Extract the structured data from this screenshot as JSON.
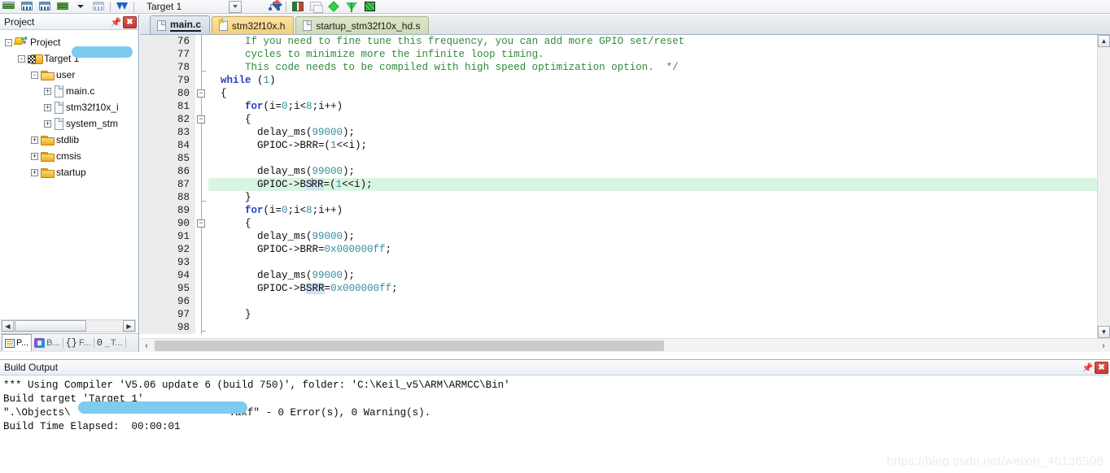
{
  "toolbar": {
    "icons": [
      "books-icon",
      "grid-build-icon",
      "grid-rebuild-icon",
      "batch-build-icon",
      "dropdown-caret-icon",
      "stop-build-icon",
      "download-icon"
    ],
    "target_label": "Target 1",
    "right_icons": [
      "target-options-icon",
      "manage-components-icon",
      "multi-project-icon",
      "debug-diamond-icon",
      "funnel-icon",
      "globe-icon"
    ]
  },
  "project_panel": {
    "title": "Project",
    "pin_glyph": "τ",
    "close_glyph": "✖",
    "tree": [
      {
        "label": "Project",
        "icon": "project-icon",
        "depth": 0,
        "expander": "-",
        "redacted": true
      },
      {
        "label": "Target 1",
        "icon": "target-icon",
        "depth": 1,
        "expander": "-",
        "redacted": false
      },
      {
        "label": "user",
        "icon": "folder-open-icon",
        "depth": 2,
        "expander": "-",
        "redacted": false
      },
      {
        "label": "main.c",
        "icon": "file-icon",
        "depth": 3,
        "expander": "+",
        "redacted": false
      },
      {
        "label": "stm32f10x_i",
        "icon": "file-icon",
        "depth": 3,
        "expander": "+",
        "redacted": false
      },
      {
        "label": "system_stm",
        "icon": "file-icon",
        "depth": 3,
        "expander": "+",
        "redacted": false
      },
      {
        "label": "stdlib",
        "icon": "folder-icon",
        "depth": 2,
        "expander": "+",
        "redacted": false
      },
      {
        "label": "cmsis",
        "icon": "folder-icon",
        "depth": 2,
        "expander": "+",
        "redacted": false
      },
      {
        "label": "startup",
        "icon": "folder-icon",
        "depth": 2,
        "expander": "+",
        "redacted": false
      }
    ],
    "bottom_tabs": [
      {
        "label": "P...",
        "icon": "project-tab-icon",
        "active": true
      },
      {
        "label": "B...",
        "icon": "books-tab-icon",
        "active": false
      },
      {
        "label": "F...",
        "icon": "functions-tab-icon",
        "active": false
      },
      {
        "label": "T...",
        "icon": "templates-tab-icon",
        "active": false
      }
    ],
    "scroll_left_glyph": "◀",
    "scroll_right_glyph": "▶"
  },
  "editor": {
    "tabs": [
      {
        "label": "main.c",
        "style": "active",
        "icon": "file-icon"
      },
      {
        "label": "stm32f10x.h",
        "style": "yellow",
        "icon": "file-key-icon"
      },
      {
        "label": "startup_stm32f10x_hd.s",
        "style": "green",
        "icon": "file-icon"
      }
    ],
    "tab_dropdown_glyph": "▼",
    "tab_close_glyph": "✕",
    "first_line": 76,
    "highlight_line": 87,
    "lines": [
      {
        "n": 76,
        "fold": "none",
        "tokens": [
          {
            "t": "      ",
            "c": "pun"
          },
          {
            "t": "If you need to fine tune this frequency, you can add more GPIO set/reset",
            "c": "cmt"
          }
        ]
      },
      {
        "n": 77,
        "fold": "none",
        "tokens": [
          {
            "t": "      ",
            "c": "pun"
          },
          {
            "t": "cycles to minimize more the infinite loop timing.",
            "c": "cmt"
          }
        ]
      },
      {
        "n": 78,
        "fold": "tick",
        "tokens": [
          {
            "t": "      ",
            "c": "pun"
          },
          {
            "t": "This code needs to be compiled with high speed optimization option.  */",
            "c": "cmt"
          }
        ]
      },
      {
        "n": 79,
        "fold": "none",
        "tokens": [
          {
            "t": "  ",
            "c": "pun"
          },
          {
            "t": "while",
            "c": "kw"
          },
          {
            "t": " (",
            "c": "pun"
          },
          {
            "t": "1",
            "c": "num"
          },
          {
            "t": ")",
            "c": "pun"
          }
        ]
      },
      {
        "n": 80,
        "fold": "box",
        "tokens": [
          {
            "t": "  {",
            "c": "pun"
          }
        ]
      },
      {
        "n": 81,
        "fold": "none",
        "tokens": [
          {
            "t": "      ",
            "c": "pun"
          },
          {
            "t": "for",
            "c": "kw"
          },
          {
            "t": "(i=",
            "c": "pun"
          },
          {
            "t": "0",
            "c": "num"
          },
          {
            "t": ";i<",
            "c": "pun"
          },
          {
            "t": "8",
            "c": "num"
          },
          {
            "t": ";i++)",
            "c": "pun"
          }
        ]
      },
      {
        "n": 82,
        "fold": "box",
        "tokens": [
          {
            "t": "      {",
            "c": "pun"
          }
        ]
      },
      {
        "n": 83,
        "fold": "none",
        "tokens": [
          {
            "t": "        delay_ms(",
            "c": "pun"
          },
          {
            "t": "99000",
            "c": "num"
          },
          {
            "t": ");",
            "c": "pun"
          }
        ]
      },
      {
        "n": 84,
        "fold": "none",
        "tokens": [
          {
            "t": "        GPIOC->BRR=(",
            "c": "pun"
          },
          {
            "t": "1",
            "c": "num"
          },
          {
            "t": "<<i);",
            "c": "pun"
          }
        ]
      },
      {
        "n": 85,
        "fold": "none",
        "tokens": []
      },
      {
        "n": 86,
        "fold": "none",
        "tokens": [
          {
            "t": "        delay_ms(",
            "c": "pun"
          },
          {
            "t": "99000",
            "c": "num"
          },
          {
            "t": ");",
            "c": "pun"
          }
        ]
      },
      {
        "n": 87,
        "fold": "none",
        "tokens": [
          {
            "t": "        GPIOC->B",
            "c": "pun"
          },
          {
            "t": "S",
            "c": "sel"
          },
          {
            "t": "|",
            "c": "caret"
          },
          {
            "t": "RR",
            "c": "sel"
          },
          {
            "t": "=(",
            "c": "pun"
          },
          {
            "t": "1",
            "c": "num"
          },
          {
            "t": "<<i);",
            "c": "pun"
          }
        ]
      },
      {
        "n": 88,
        "fold": "tick",
        "tokens": [
          {
            "t": "      }",
            "c": "pun"
          }
        ]
      },
      {
        "n": 89,
        "fold": "none",
        "tokens": [
          {
            "t": "      ",
            "c": "pun"
          },
          {
            "t": "for",
            "c": "kw"
          },
          {
            "t": "(i=",
            "c": "pun"
          },
          {
            "t": "0",
            "c": "num"
          },
          {
            "t": ";i<",
            "c": "pun"
          },
          {
            "t": "8",
            "c": "num"
          },
          {
            "t": ";i++)",
            "c": "pun"
          }
        ]
      },
      {
        "n": 90,
        "fold": "box",
        "tokens": [
          {
            "t": "      {",
            "c": "pun"
          }
        ]
      },
      {
        "n": 91,
        "fold": "none",
        "tokens": [
          {
            "t": "        delay_ms(",
            "c": "pun"
          },
          {
            "t": "99000",
            "c": "num"
          },
          {
            "t": ");",
            "c": "pun"
          }
        ]
      },
      {
        "n": 92,
        "fold": "none",
        "tokens": [
          {
            "t": "        GPIOC->BRR=",
            "c": "pun"
          },
          {
            "t": "0x000000ff",
            "c": "num"
          },
          {
            "t": ";",
            "c": "pun"
          }
        ]
      },
      {
        "n": 93,
        "fold": "none",
        "tokens": []
      },
      {
        "n": 94,
        "fold": "none",
        "tokens": [
          {
            "t": "        delay_ms(",
            "c": "pun"
          },
          {
            "t": "99000",
            "c": "num"
          },
          {
            "t": ");",
            "c": "pun"
          }
        ]
      },
      {
        "n": 95,
        "fold": "none",
        "tokens": [
          {
            "t": "        GPIOC->B",
            "c": "pun"
          },
          {
            "t": "SRR",
            "c": "sel"
          },
          {
            "t": "=",
            "c": "pun"
          },
          {
            "t": "0x000000ff",
            "c": "num"
          },
          {
            "t": ";",
            "c": "pun"
          }
        ]
      },
      {
        "n": 96,
        "fold": "none",
        "tokens": []
      },
      {
        "n": 97,
        "fold": "none",
        "tokens": [
          {
            "t": "      }",
            "c": "pun"
          }
        ]
      },
      {
        "n": 98,
        "fold": "tick",
        "tokens": []
      }
    ],
    "v_scroll_up_glyph": "▲",
    "v_scroll_dn_glyph": "▼",
    "h_scroll_left_glyph": "‹",
    "h_scroll_right_glyph": "›"
  },
  "build_output": {
    "title": "Build Output",
    "pin_glyph": "τ",
    "close_glyph": "✖",
    "lines": [
      "*** Using Compiler 'V5.06 update 6 (build 750)', folder: 'C:\\Keil_v5\\ARM\\ARMCC\\Bin'",
      "Build target 'Target 1'",
      "\".\\Objects\\                          .axf\" - 0 Error(s), 0 Warning(s).",
      "Build Time Elapsed:  00:00:01"
    ],
    "redacted": true
  },
  "watermark": "https://blog.csdn.net/weixin_46136508",
  "colors": {
    "comment": "#2e8b3a",
    "keyword": "#2b3cc4",
    "number": "#2f8f9e",
    "current_line": "#d9f5e2",
    "selection": "#cfe3f5",
    "redaction": "#7ecbf0",
    "tab_yellow": "#f5cf78",
    "tab_green": "#cddcb3"
  }
}
